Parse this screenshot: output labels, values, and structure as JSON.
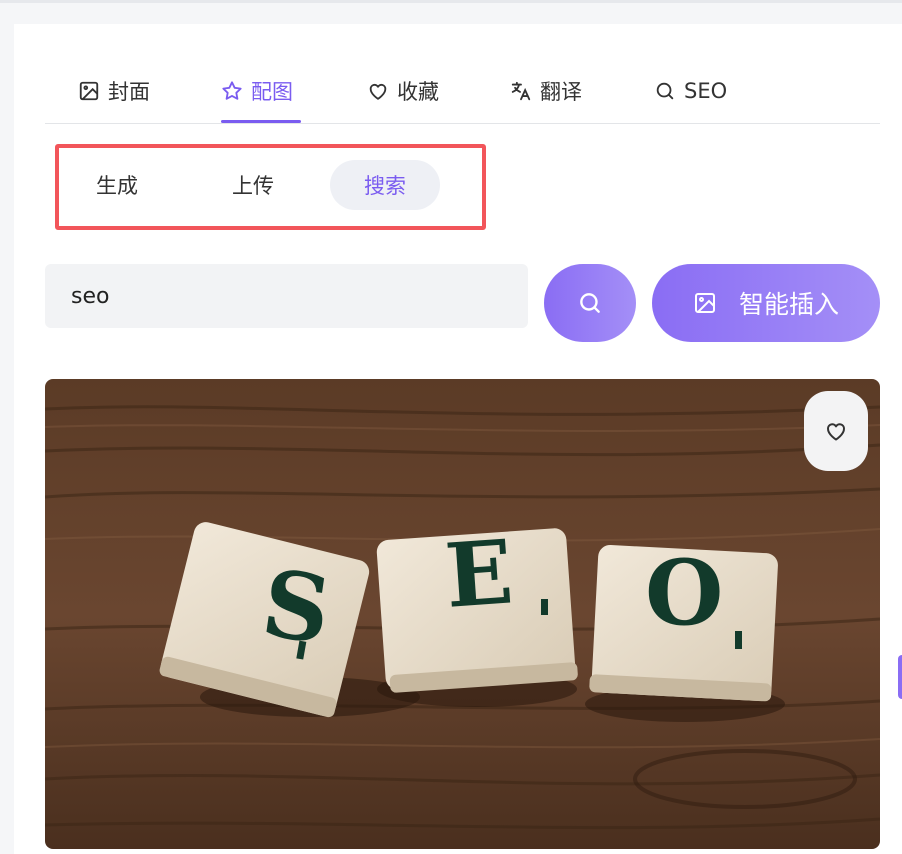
{
  "tabs": [
    {
      "label": "封面",
      "icon": "image-icon",
      "active": false
    },
    {
      "label": "配图",
      "icon": "star-icon",
      "active": true
    },
    {
      "label": "收藏",
      "icon": "heart-icon",
      "active": false
    },
    {
      "label": "翻译",
      "icon": "translate-icon",
      "active": false
    },
    {
      "label": "SEO",
      "icon": "search-icon",
      "active": false
    }
  ],
  "subtabs": [
    {
      "label": "生成",
      "active": false
    },
    {
      "label": "上传",
      "active": false
    },
    {
      "label": "搜索",
      "active": true
    }
  ],
  "search": {
    "value": "seo",
    "button_icon": "search-icon"
  },
  "insert_button": {
    "label": "智能插入",
    "icon": "image-icon"
  },
  "result_image": {
    "tiles": [
      {
        "letter": "S"
      },
      {
        "letter": "E"
      },
      {
        "letter": "O"
      }
    ],
    "favorite_icon": "heart-icon"
  },
  "colors": {
    "accent": "#7a5cf0",
    "highlight_border": "#f2555a"
  }
}
